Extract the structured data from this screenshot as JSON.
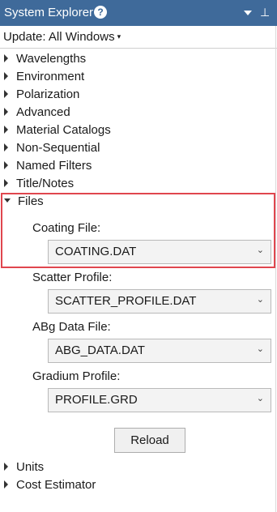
{
  "panel": {
    "title": "System Explorer",
    "help_glyph": "?",
    "pin_glyph": "⊥"
  },
  "update": {
    "label": "Update: All Windows",
    "caret": "▾"
  },
  "tree": {
    "wavelengths": "Wavelengths",
    "environment": "Environment",
    "polarization": "Polarization",
    "advanced": "Advanced",
    "material_catalogs": "Material Catalogs",
    "non_sequential": "Non-Sequential",
    "named_filters": "Named Filters",
    "title_notes": "Title/Notes",
    "files": "Files",
    "units": "Units",
    "cost_estimator": "Cost Estimator"
  },
  "files": {
    "coating_label": "Coating File:",
    "coating_value": "COATING.DAT",
    "scatter_label": "Scatter Profile:",
    "scatter_value": "SCATTER_PROFILE.DAT",
    "abg_label": "ABg Data File:",
    "abg_value": "ABG_DATA.DAT",
    "gradium_label": "Gradium Profile:",
    "gradium_value": "PROFILE.GRD",
    "reload_label": "Reload",
    "chevron": "⌄"
  },
  "colors": {
    "titlebar": "#3f6a9a",
    "highlight": "#e0464e"
  }
}
